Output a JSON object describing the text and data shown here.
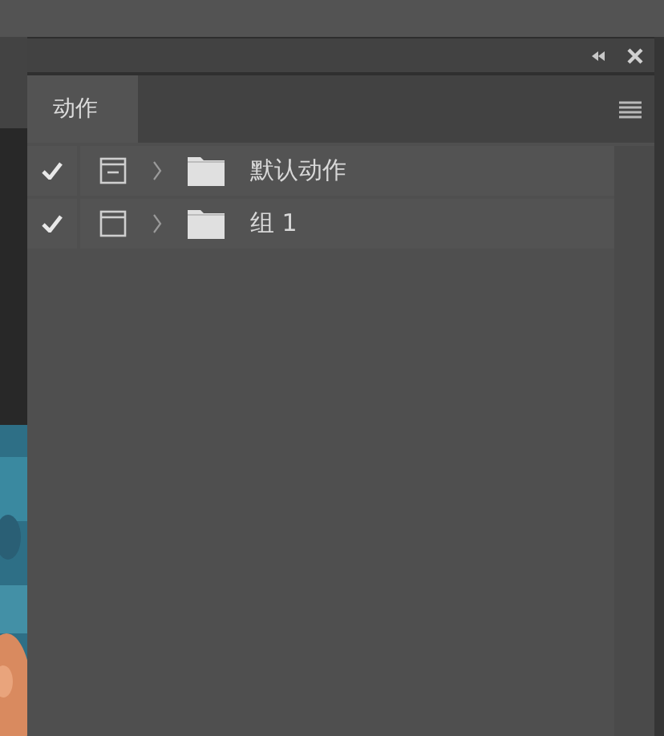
{
  "panel": {
    "tabs": [
      {
        "label": "动作",
        "selected": true
      }
    ]
  },
  "actions": [
    {
      "name": "默认动作",
      "checked": true,
      "dialog_partial": true,
      "expanded": false
    },
    {
      "name": "组 1",
      "checked": true,
      "dialog_partial": false,
      "expanded": false
    }
  ]
}
